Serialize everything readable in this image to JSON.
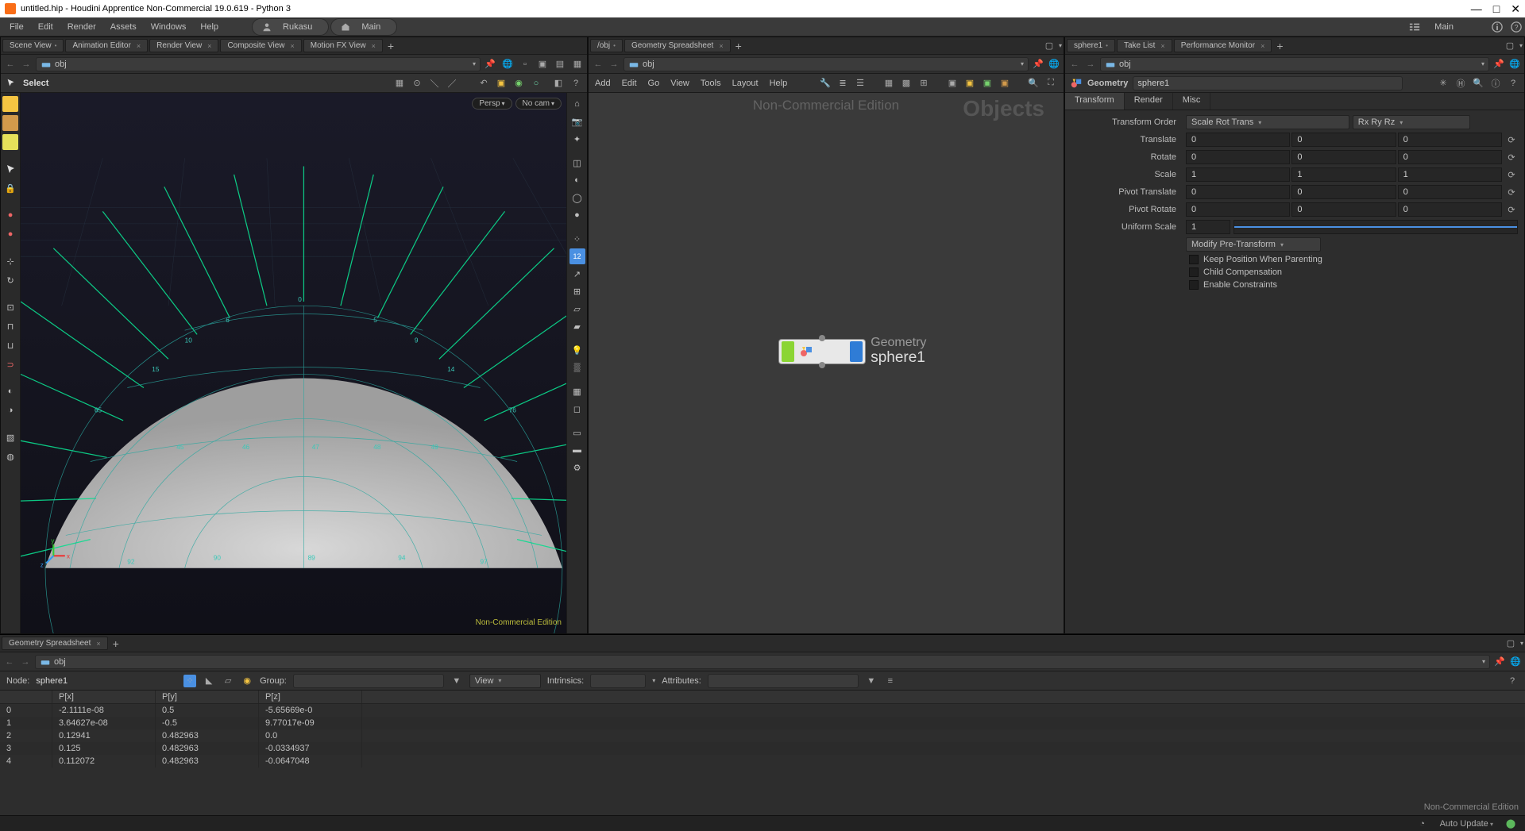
{
  "window": {
    "title": "untitled.hip - Houdini Apprentice Non-Commercial 19.0.619 - Python 3"
  },
  "window_controls": {
    "min": "—",
    "max": "□",
    "close": "✕"
  },
  "menubar": {
    "items": [
      "File",
      "Edit",
      "Render",
      "Assets",
      "Windows",
      "Help"
    ]
  },
  "shelves": {
    "user": "Rukasu",
    "desktop": "Main",
    "right_desktop": "Main"
  },
  "scene_pane": {
    "tabs": [
      "Scene View",
      "Animation Editor",
      "Render View",
      "Composite View",
      "Motion FX View"
    ],
    "path": "obj",
    "tool_label": "Select",
    "cam1": "Persp",
    "cam2": "No cam",
    "watermark": "Non-Commercial Edition"
  },
  "node_pane": {
    "tabs": [
      "/obj",
      "Geometry Spreadsheet"
    ],
    "path": "obj",
    "menu": [
      "Add",
      "Edit",
      "Go",
      "View",
      "Tools",
      "Layout",
      "Help"
    ],
    "nc": "Non-Commercial Edition",
    "context": "Objects",
    "node_type": "Geometry",
    "node_name": "sphere1"
  },
  "param_pane": {
    "tabs": [
      "sphere1",
      "Take List",
      "Performance Monitor"
    ],
    "path": "obj",
    "type_label": "Geometry",
    "name": "sphere1",
    "subtabs": [
      "Transform",
      "Render",
      "Misc"
    ],
    "rows": {
      "transform_order": {
        "label": "Transform Order",
        "v1": "Scale Rot Trans",
        "v2": "Rx Ry Rz"
      },
      "translate": {
        "label": "Translate",
        "v": [
          "0",
          "0",
          "0"
        ]
      },
      "rotate": {
        "label": "Rotate",
        "v": [
          "0",
          "0",
          "0"
        ]
      },
      "scale": {
        "label": "Scale",
        "v": [
          "1",
          "1",
          "1"
        ]
      },
      "pivot_translate": {
        "label": "Pivot Translate",
        "v": [
          "0",
          "0",
          "0"
        ]
      },
      "pivot_rotate": {
        "label": "Pivot Rotate",
        "v": [
          "0",
          "0",
          "0"
        ]
      },
      "uniform_scale": {
        "label": "Uniform Scale",
        "v": "1"
      },
      "modify_pre": "Modify Pre-Transform",
      "keep_pos": "Keep Position When Parenting",
      "child_comp": "Child Compensation",
      "enable_con": "Enable Constraints"
    }
  },
  "spreadsheet": {
    "tab": "Geometry Spreadsheet",
    "path": "obj",
    "node_label": "Node:",
    "node_value": "sphere1",
    "group_label": "Group:",
    "view_label": "View",
    "intrinsics_label": "Intrinsics:",
    "attributes_label": "Attributes:",
    "columns": [
      "",
      "P[x]",
      "P[y]",
      "P[z]"
    ],
    "rows": [
      [
        "0",
        "-2.1111e-08",
        "0.5",
        "-5.65669e-0"
      ],
      [
        "1",
        "3.64627e-08",
        "-0.5",
        "9.77017e-09"
      ],
      [
        "2",
        "0.12941",
        "0.482963",
        "0.0"
      ],
      [
        "3",
        "0.125",
        "0.482963",
        "-0.0334937"
      ],
      [
        "4",
        "0.112072",
        "0.482963",
        "-0.0647048"
      ]
    ],
    "nc": "Non-Commercial Edition"
  },
  "statusbar": {
    "auto_update": "Auto Update"
  }
}
